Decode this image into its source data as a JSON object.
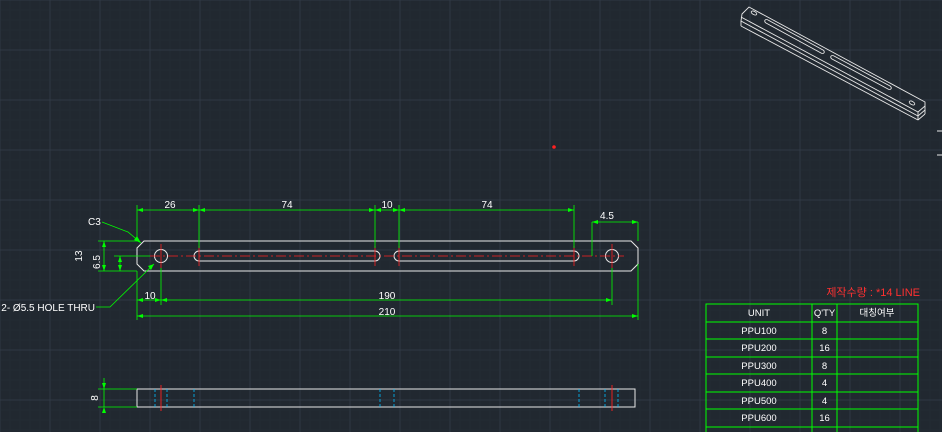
{
  "colors": {
    "background": "#212830",
    "grid_major": "#2f3944",
    "grid_minor": "#262e37",
    "geometry": "#e8e8e8",
    "dimension": "#00ff00",
    "centerline": "#ff2020",
    "hidden": "#00bfff",
    "table_border": "#00ff00",
    "annotation_red": "#ff3030"
  },
  "drawing": {
    "top_view": {
      "chamfer_label": "C3",
      "hole_note": "2- Ø5.5 HOLE THRU",
      "dims": {
        "d26": "26",
        "d74a": "74",
        "d10a": "10",
        "d74b": "74",
        "d4_5": "4.5",
        "d13": "13",
        "d6_5": "6.5",
        "d10b": "10",
        "d190": "190",
        "d210": "210"
      }
    },
    "side_view": {
      "dims": {
        "d8": "8"
      }
    }
  },
  "production_note": "제작수량 : *14 LINE",
  "table": {
    "headers": [
      "UNIT",
      "Q'TY",
      "대칭여부"
    ],
    "rows": [
      [
        "PPU100",
        "8",
        ""
      ],
      [
        "PPU200",
        "16",
        ""
      ],
      [
        "PPU300",
        "8",
        ""
      ],
      [
        "PPU400",
        "4",
        ""
      ],
      [
        "PPU500",
        "4",
        ""
      ],
      [
        "PPU600",
        "16",
        ""
      ]
    ]
  }
}
